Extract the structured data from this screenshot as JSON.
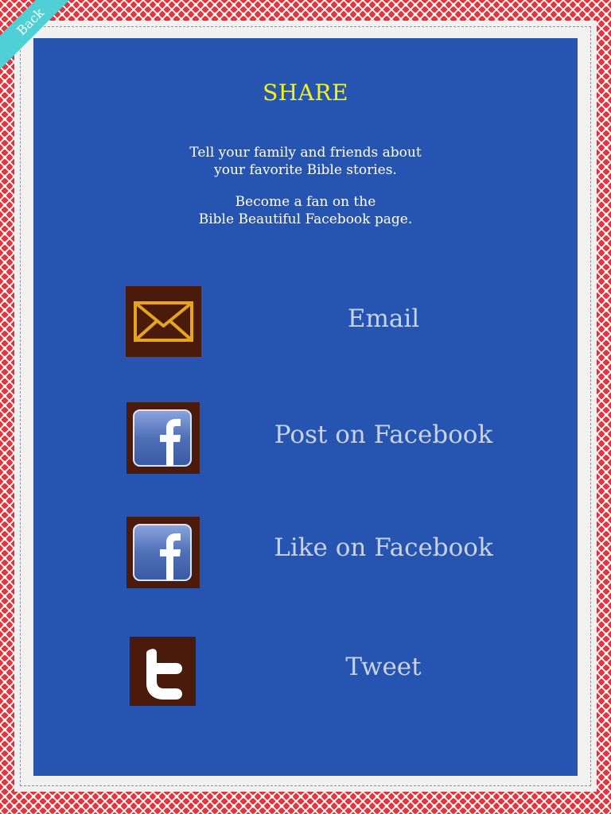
{
  "back_label": "Back",
  "title": "SHARE",
  "intro": {
    "line1": "Tell your family and friends about",
    "line2": "your favorite Bible stories.",
    "line3": "Become a fan on the",
    "line4": "Bible Beautiful Facebook page."
  },
  "actions": [
    {
      "label": "Email",
      "icon": "envelope-icon"
    },
    {
      "label": "Post on Facebook",
      "icon": "facebook-icon"
    },
    {
      "label": "Like on Facebook",
      "icon": "facebook-icon"
    },
    {
      "label": "Tweet",
      "icon": "twitter-icon"
    }
  ],
  "colors": {
    "panel": "#2555b0",
    "title": "#f4f21c",
    "label": "#c9d2e6",
    "icon_bg": "#4a1a0b",
    "back_tab": "#4fd0d6"
  }
}
